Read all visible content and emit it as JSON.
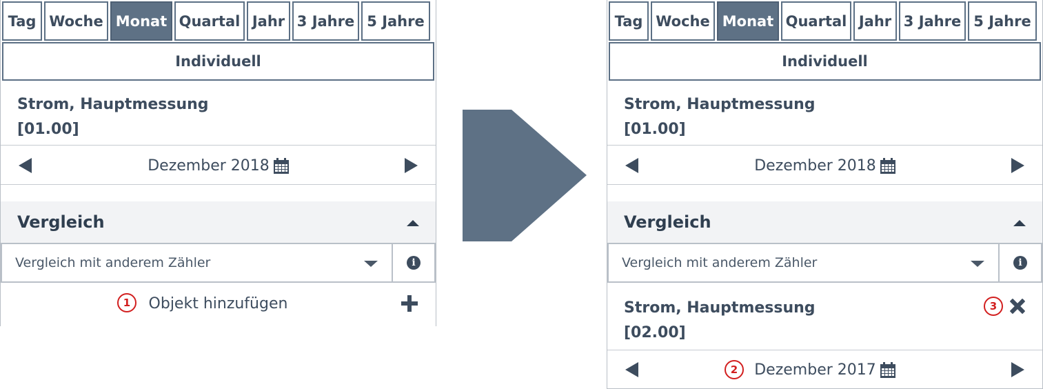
{
  "tabs": [
    "Tag",
    "Woche",
    "Monat",
    "Quartal",
    "Jahr",
    "3 Jahre",
    "5 Jahre"
  ],
  "active_tab": "Monat",
  "custom_tab": "Individuell",
  "meter": {
    "name": "Strom, Hauptmessung",
    "id": "[01.00]"
  },
  "period": "Dezember 2018",
  "compare": {
    "title": "Vergleich",
    "select_value": "Vergleich mit anderem Zähler",
    "add_label": "Objekt hinzufügen"
  },
  "compare_meter": {
    "name": "Strom, Hauptmessung",
    "id": "[02.00]"
  },
  "compare_period": "Dezember 2017",
  "badges": {
    "one": "1",
    "two": "2",
    "three": "3"
  },
  "colors": {
    "accent": "#5e7185",
    "text": "#3d4c5e",
    "badge": "#d21f1f",
    "arrow": "#5e7185"
  },
  "icons": [
    "calendar-icon",
    "info-icon",
    "plus-icon",
    "close-icon",
    "prev-arrow-icon",
    "next-arrow-icon",
    "caret-up-icon",
    "caret-down-icon"
  ]
}
